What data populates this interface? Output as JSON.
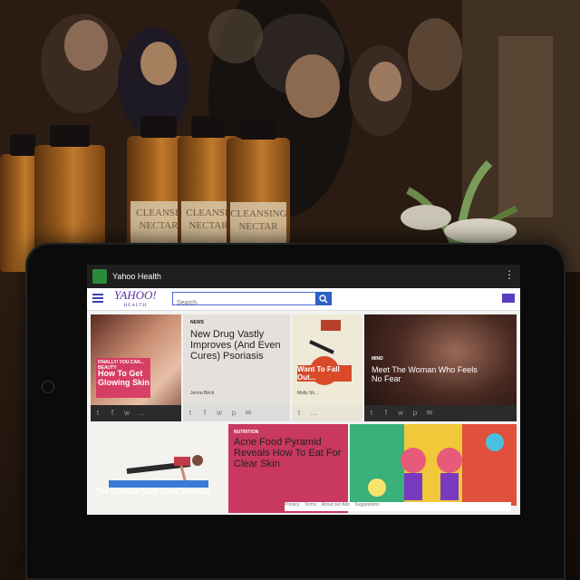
{
  "app": {
    "title": "Yahoo Health"
  },
  "header": {
    "logo": "YAHOO!",
    "logo_sub": "HEALTH",
    "search_placeholder": "Search"
  },
  "cards": [
    {
      "tag": "FINALLY! YOU CAN... BEAUTY",
      "headline": "How To Get Glowing Skin"
    },
    {
      "tag": "NEWS",
      "headline": "New Drug Vastly Improves (And Even Cures) Psoriasis",
      "author": "Jenna Birch"
    },
    {
      "headline": "Want To Fall Out...",
      "author": "Molly Sh..."
    },
    {
      "tag": "MIND",
      "headline": "Meet The Woman Who Feels No Fear"
    },
    {
      "headline": "The Ultimate Sexy Arms Workout"
    },
    {
      "tag": "NUTRITION",
      "headline": "Acne Food Pyramid Reveals How To Eat For Clear Skin"
    },
    {
      "headline": ""
    }
  ],
  "share_icons": [
    "t",
    "f",
    "tw",
    "p",
    "mail",
    "more"
  ],
  "footer": {
    "links": [
      "Privacy",
      "Terms",
      "About our Ads",
      "Suggestions"
    ]
  },
  "bottle_labels": [
    "CLEANSE NECTAR",
    "CLEANSE NECTAR",
    "CLEANSING NECTAR"
  ],
  "colors": {
    "accent": "#5a2fa0",
    "beauty_pink": "#d6345f",
    "acne_pink": "#c8385f"
  }
}
